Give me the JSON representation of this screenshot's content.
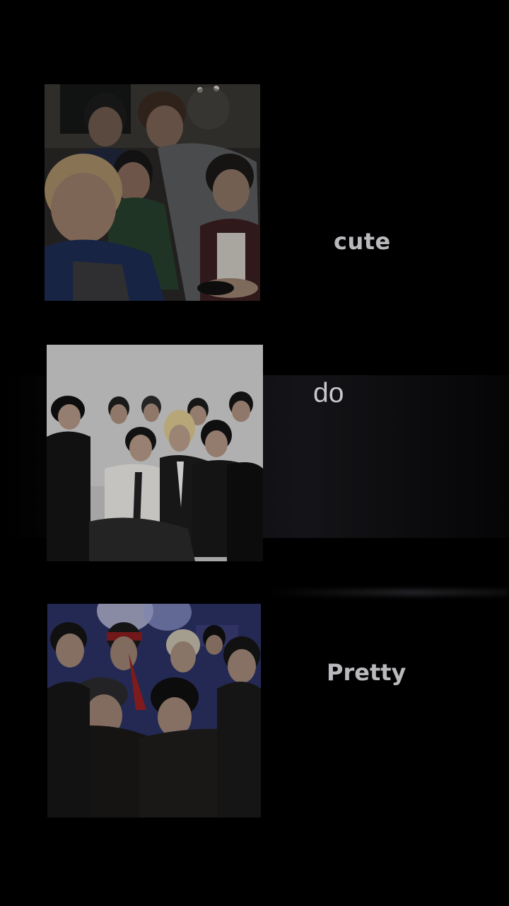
{
  "photos": [
    {
      "description_icon": "group-selfie-image"
    },
    {
      "description_icon": "group-studio-photo-image"
    },
    {
      "description_icon": "group-stage-photo-image"
    }
  ],
  "captions": {
    "first": "cute",
    "second": "do",
    "third": "Pretty"
  },
  "colors": {
    "background": "#000000",
    "caption_text": "#b9b9bd"
  }
}
